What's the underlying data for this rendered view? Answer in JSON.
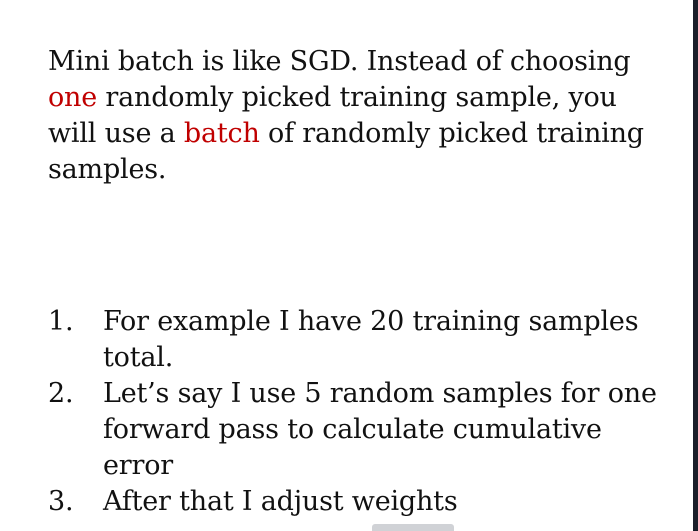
{
  "slide": {
    "intro": {
      "part1": "Mini batch is like SGD. Instead of choosing ",
      "highlight1": "one",
      "part2": " randomly picked training sample, you will use a ",
      "highlight2": "batch",
      "part3": " of randomly picked training samples."
    },
    "steps": [
      {
        "number": "1.",
        "text": "For example I have 20 training samples total."
      },
      {
        "number": "2.",
        "text": "Let’s say I use 5 random samples for one forward pass to calculate cumulative error"
      },
      {
        "number": "3.",
        "text": "After that I adjust weights"
      }
    ]
  },
  "colors": {
    "highlight": "#c00000",
    "text": "#111111",
    "background": "#ffffff"
  }
}
